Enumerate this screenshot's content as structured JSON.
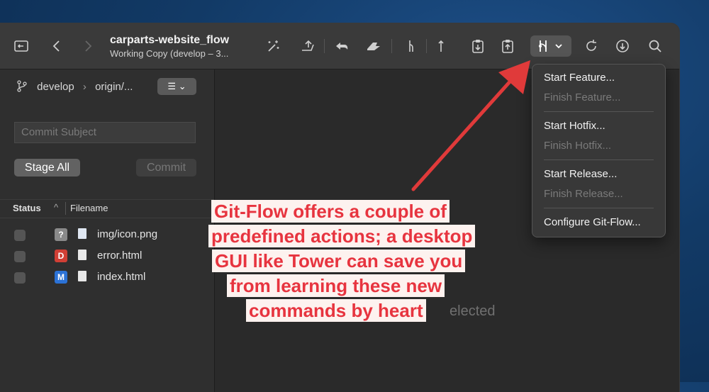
{
  "toolbar": {
    "repo_name": "carparts-website_flow",
    "repo_status": "Working Copy (develop – 3...",
    "icons": [
      "sidebar-toggle-icon",
      "back-icon",
      "forward-icon",
      "wand-icon",
      "undo-icon",
      "revert-icon",
      "stash-icon",
      "merge-icon",
      "push-icon",
      "pull-request-icon",
      "fetch-icon",
      "git-flow-icon",
      "refresh-icon",
      "download-icon",
      "search-icon"
    ]
  },
  "sidebar": {
    "branch": "develop",
    "remote": "origin/...",
    "commit_placeholder": "Commit Subject",
    "stage_all_label": "Stage All",
    "commit_label": "Commit",
    "columns": {
      "status": "Status",
      "filename": "Filename"
    },
    "files": [
      {
        "badge": "?",
        "badge_color": "#8a8a8a",
        "name": "img/icon.png"
      },
      {
        "badge": "D",
        "badge_color": "#d13f35",
        "name": "error.html"
      },
      {
        "badge": "M",
        "badge_color": "#2b72d6",
        "name": "index.html"
      }
    ]
  },
  "main": {
    "empty_text": "elected"
  },
  "gitflow_menu": {
    "items": [
      {
        "label": "Start Feature...",
        "enabled": true
      },
      {
        "label": "Finish Feature...",
        "enabled": false
      },
      {
        "label": "Start Hotfix...",
        "enabled": true
      },
      {
        "label": "Finish Hotfix...",
        "enabled": false
      },
      {
        "label": "Start Release...",
        "enabled": true
      },
      {
        "label": "Finish Release...",
        "enabled": false
      },
      {
        "label": "Configure Git-Flow...",
        "enabled": true
      }
    ]
  },
  "callout": {
    "lines": [
      "Git-Flow offers  a couple of",
      "predefined actions; a desktop",
      "GUI like Tower can save you",
      "from learning these new",
      "commands by heart"
    ],
    "color": "#e7343f"
  }
}
